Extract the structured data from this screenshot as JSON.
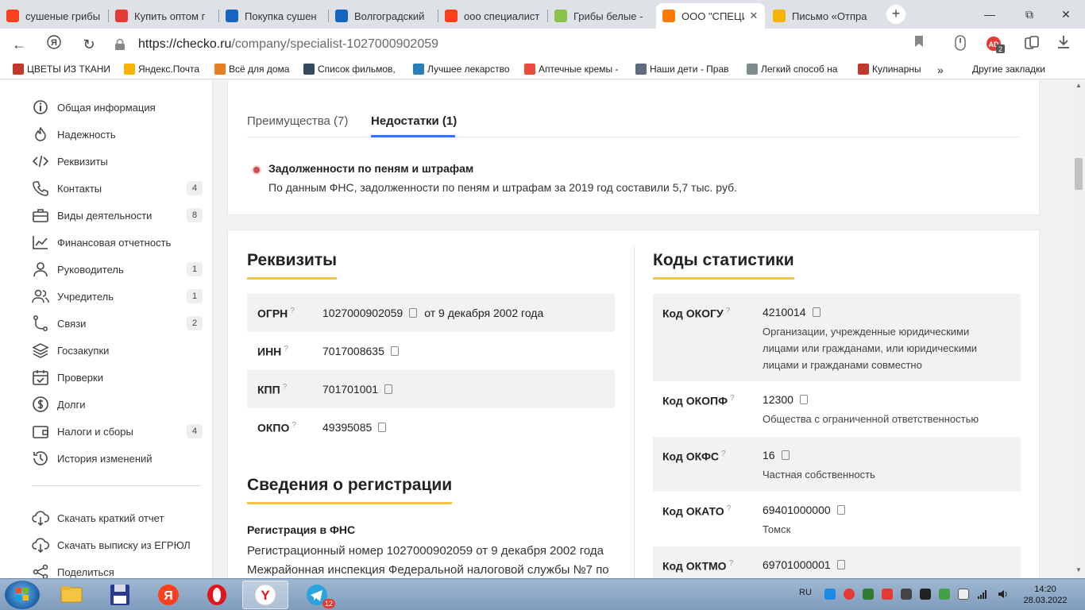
{
  "browser": {
    "tabs": [
      {
        "title": "сушеные грибы",
        "favicon": "yandex-icon",
        "color": "#fc3f1d"
      },
      {
        "title": "Купить оптом г",
        "favicon": "store-icon",
        "color": "#e53935"
      },
      {
        "title": "Покупка сушен",
        "favicon": "vf-icon",
        "color": "#1565c0"
      },
      {
        "title": "Волгоградский",
        "favicon": "vf-icon",
        "color": "#1565c0"
      },
      {
        "title": "ооо специалист",
        "favicon": "yandex-icon",
        "color": "#fc3f1d"
      },
      {
        "title": "Грибы белые -",
        "favicon": "chart-icon",
        "color": "#8bc34a"
      },
      {
        "title": "ООО \"СПЕЦИ",
        "favicon": "flame-icon",
        "color": "#ff7a00",
        "active": true
      },
      {
        "title": "Письмо «Отпра",
        "favicon": "mail-icon",
        "color": "#f5b400"
      }
    ],
    "url_host": "https://checko.ru",
    "url_path": "/company/specialist-1027000902059",
    "ext_badge": "2",
    "bookmarks": [
      {
        "label": "ЦВЕТЫ ИЗ ТКАНИ",
        "icon": "flower-icon"
      },
      {
        "label": "Яндекс.Почта",
        "icon": "mail-icon"
      },
      {
        "label": "Всё для дома",
        "icon": "home-icon"
      },
      {
        "label": "Список фильмов,",
        "icon": "user-icon"
      },
      {
        "label": "Лучшее лекарство",
        "icon": "link-icon"
      },
      {
        "label": "Аптечные кремы -",
        "icon": "ns-icon"
      },
      {
        "label": "Наши дети - Прав",
        "icon": "page-icon"
      },
      {
        "label": "Легкий способ на",
        "icon": "gt-icon"
      },
      {
        "label": "Кулинарны",
        "icon": "cook-icon"
      }
    ],
    "more_bookmarks": "»",
    "other_bookmarks": "Другие закладки"
  },
  "sidebar": {
    "items": [
      {
        "label": "Общая информация",
        "icon": "info-icon",
        "count": ""
      },
      {
        "label": "Надежность",
        "icon": "flame-icon",
        "count": ""
      },
      {
        "label": "Реквизиты",
        "icon": "code-icon",
        "count": ""
      },
      {
        "label": "Контакты",
        "icon": "phone-icon",
        "count": "4"
      },
      {
        "label": "Виды деятельности",
        "icon": "briefcase-icon",
        "count": "8"
      },
      {
        "label": "Финансовая отчетность",
        "icon": "chart-line-icon",
        "count": ""
      },
      {
        "label": "Руководитель",
        "icon": "person-icon",
        "count": "1"
      },
      {
        "label": "Учредитель",
        "icon": "people-icon",
        "count": "1"
      },
      {
        "label": "Связи",
        "icon": "graph-icon",
        "count": "2"
      },
      {
        "label": "Госзакупки",
        "icon": "layers-icon",
        "count": ""
      },
      {
        "label": "Проверки",
        "icon": "calendar-check-icon",
        "count": ""
      },
      {
        "label": "Долги",
        "icon": "dollar-icon",
        "count": ""
      },
      {
        "label": "Налоги и сборы",
        "icon": "wallet-icon",
        "count": "4"
      },
      {
        "label": "История изменений",
        "icon": "history-icon",
        "count": ""
      }
    ],
    "actions": [
      {
        "label": "Скачать краткий отчет",
        "icon": "cloud-download-icon"
      },
      {
        "label": "Скачать выписку из ЕГРЮЛ",
        "icon": "cloud-download-icon"
      },
      {
        "label": "Поделиться",
        "icon": "share-icon"
      }
    ]
  },
  "proscons": {
    "tab_pros": "Преимущества (7)",
    "tab_cons": "Недостатки (1)",
    "disadvantage_title": "Задолженности по пеням и штрафам",
    "disadvantage_text": "По данным ФНС, задолженности по пеням и штрафам за 2019 год составили 5,7 тыс. руб."
  },
  "requisites": {
    "title": "Реквизиты",
    "rows": [
      {
        "key": "ОГРН",
        "value": "1027000902059",
        "extra": "от 9 декабря 2002 года"
      },
      {
        "key": "ИНН",
        "value": "7017008635",
        "extra": ""
      },
      {
        "key": "КПП",
        "value": "701701001",
        "extra": ""
      },
      {
        "key": "ОКПО",
        "value": "49395085",
        "extra": ""
      }
    ],
    "help_mark": "?"
  },
  "registration": {
    "title": "Сведения о регистрации",
    "label": "Регистрация в ФНС",
    "line1": "Регистрационный номер 1027000902059 от 9 декабря 2002 года",
    "line2": "Межрайонная инспекция Федеральной налоговой службы №7 по"
  },
  "stat_codes": {
    "title": "Коды статистики",
    "rows": [
      {
        "key": "Код ОКОГУ",
        "value": "4210014",
        "desc": "Организации, учрежденные юридическими лицами или гражданами, или юридическими лицами и гражданами совместно"
      },
      {
        "key": "Код ОКОПФ",
        "value": "12300",
        "desc": "Общества с ограниченной ответственностью"
      },
      {
        "key": "Код ОКФС",
        "value": "16",
        "desc": "Частная собственность"
      },
      {
        "key": "Код ОКАТО",
        "value": "69401000000",
        "desc": "Томск"
      },
      {
        "key": "Код ОКТМО",
        "value": "69701000001",
        "desc": ""
      }
    ]
  },
  "taskbar": {
    "apps": [
      {
        "name": "explorer-icon"
      },
      {
        "name": "save-app-icon"
      },
      {
        "name": "yandex-icon"
      },
      {
        "name": "opera-icon"
      },
      {
        "name": "yandex-browser-icon",
        "active": true
      },
      {
        "name": "telegram-icon",
        "badge": "12"
      }
    ],
    "lang": "RU",
    "time": "14:20",
    "date": "28.03.2022"
  }
}
